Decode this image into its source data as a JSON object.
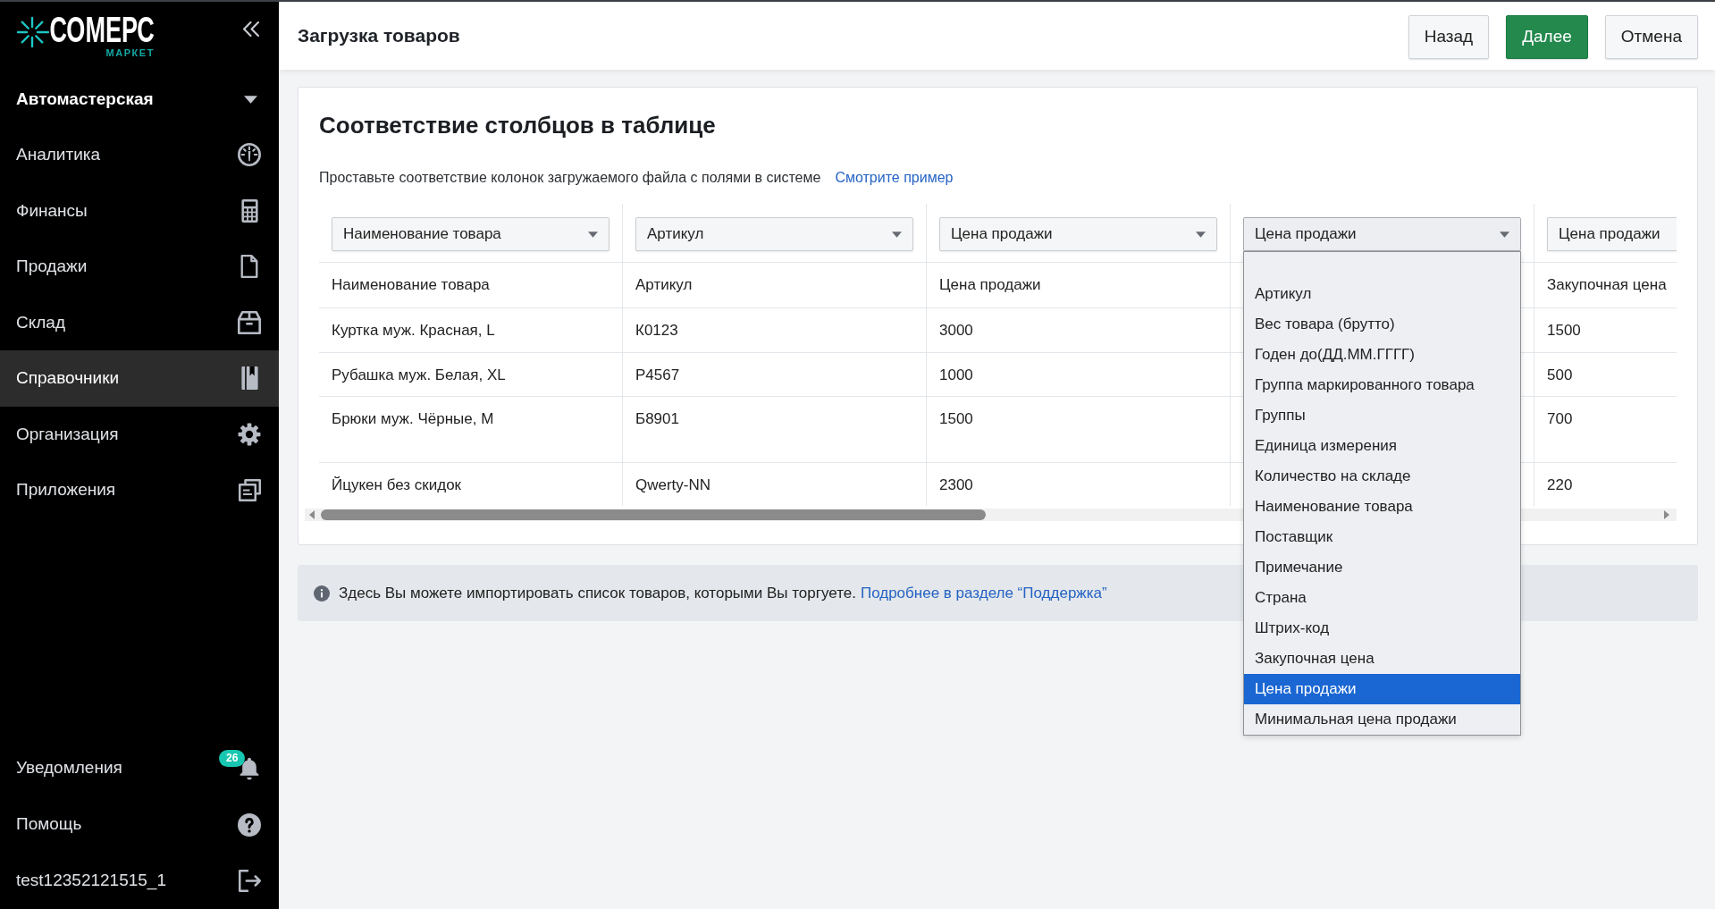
{
  "sidebar": {
    "logo": {
      "wordmark": "СОМЕРС",
      "tagline": "МАРКЕТ"
    },
    "store": {
      "label": "Автомастерская"
    },
    "items": [
      {
        "label": "Аналитика",
        "selected": false
      },
      {
        "label": "Финансы",
        "selected": false
      },
      {
        "label": "Продажи",
        "selected": false
      },
      {
        "label": "Склад",
        "selected": false
      },
      {
        "label": "Справочники",
        "selected": true
      },
      {
        "label": "Организация",
        "selected": false
      },
      {
        "label": "Приложения",
        "selected": false
      }
    ],
    "footer_items": [
      {
        "label": "Уведомления",
        "badge": "26"
      },
      {
        "label": "Помощь"
      },
      {
        "label": "test12352121515_1"
      }
    ]
  },
  "header": {
    "title": "Загрузка товаров",
    "buttons": [
      {
        "label": "Назад",
        "kind": "secondary"
      },
      {
        "label": "Далее",
        "kind": "primary"
      },
      {
        "label": "Отмена",
        "kind": "secondary"
      }
    ]
  },
  "mapping_card": {
    "title": "Соответствие столбцов в таблице",
    "description": "Проставьте соответствие колонок загружаемого файла с полями в системе",
    "example_link": "Смотрите пример",
    "columns": [
      {
        "select": "Наименование товара",
        "open": false,
        "header": "Наименование товара"
      },
      {
        "select": "Артикул",
        "open": false,
        "header": "Артикул"
      },
      {
        "select": "Цена продажи",
        "open": false,
        "header": "Цена продажи"
      },
      {
        "select": "Цена продажи",
        "open": true,
        "options": [
          {
            "label": "Артикул",
            "selected": false
          },
          {
            "label": "Вес товара (брутто)",
            "selected": false
          },
          {
            "label": "Годен до(ДД.ММ.ГГГГ)",
            "selected": false
          },
          {
            "label": "Группа маркированного товара",
            "selected": false
          },
          {
            "label": "Группы",
            "selected": false
          },
          {
            "label": "Единица измерения",
            "selected": false
          },
          {
            "label": "Количество на складе",
            "selected": false
          },
          {
            "label": "Наименование товара",
            "selected": false
          },
          {
            "label": "Поставщик",
            "selected": false
          },
          {
            "label": "Примечание",
            "selected": false
          },
          {
            "label": "Страна",
            "selected": false
          },
          {
            "label": "Штрих-код",
            "selected": false
          },
          {
            "label": "Закупочная цена",
            "selected": false
          },
          {
            "label": "Цена продажи",
            "selected": true
          },
          {
            "label": "Минимальная цена продажи",
            "selected": false
          }
        ]
      },
      {
        "select": "Цена продажи",
        "open": false,
        "header": "Закупочная цена"
      }
    ],
    "rows": [
      [
        "Куртка муж. Красная, L",
        "К0123",
        "3000",
        null,
        "1500"
      ],
      [
        "Рубашка муж. Белая, XL",
        "Р4567",
        "1000",
        null,
        "500"
      ],
      [
        "Брюки муж. Чёрные, M",
        "Б8901",
        "1500",
        null,
        "700"
      ],
      [
        "Йцукен без скидок",
        "Qwerty-NN",
        "2300",
        null,
        "220"
      ]
    ]
  },
  "info_bar": {
    "text": "Здесь Вы можете импортировать список товаров, которыми Вы торгуете.",
    "link": "Подробнее в разделе “Поддержка”"
  }
}
